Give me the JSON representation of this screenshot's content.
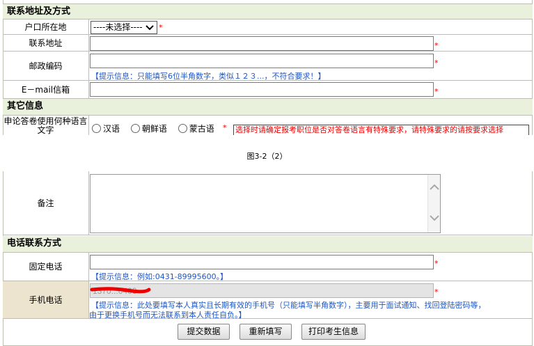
{
  "section1": {
    "title": "联系地址及方式",
    "household_label": "户口所在地",
    "household_select": "----未选择----",
    "address_label": "联系地址",
    "postcode_label": "邮政编码",
    "postcode_hint": "【提示信息：只能填写6位半角数字，类似１２３...，不符合要求！】",
    "email_label": "E－mail信箱",
    "required_mark": "*"
  },
  "section2": {
    "title": "其它信息",
    "language_label": "申论答卷使用何种语言文字",
    "options": [
      "汉语",
      "朝鲜语",
      "蒙古语"
    ],
    "language_note": "选择时请确定报考职位是否对答卷语言有特殊要求，请特殊要求的请按要求选择"
  },
  "figure_caption": "图3-2（2）",
  "remarks": {
    "label": "备注"
  },
  "section3": {
    "title": "电话联系方式",
    "landline_label": "固定电话",
    "landline_hint": "【提示信息：例如:0431-89995600。】",
    "mobile_label": "手机电话",
    "mobile_value": "1370...0400",
    "mobile_hint_1": "【提示信息：此处要填写本人真实且长期有效的手机号（只能填写半角数字），主要用于面试通知、找回登陆密码等，",
    "mobile_hint_2": "由于更换手机号而无法联系到本人责任自负。】"
  },
  "buttons": {
    "submit": "提交数据",
    "reset": "重新填写",
    "print": "打印考生信息"
  },
  "colors": {
    "section_bg": "#e9f0dc",
    "hint": "#1f57c3",
    "warning": "#e00000",
    "mobile_row_bg": "#ede4d0"
  }
}
